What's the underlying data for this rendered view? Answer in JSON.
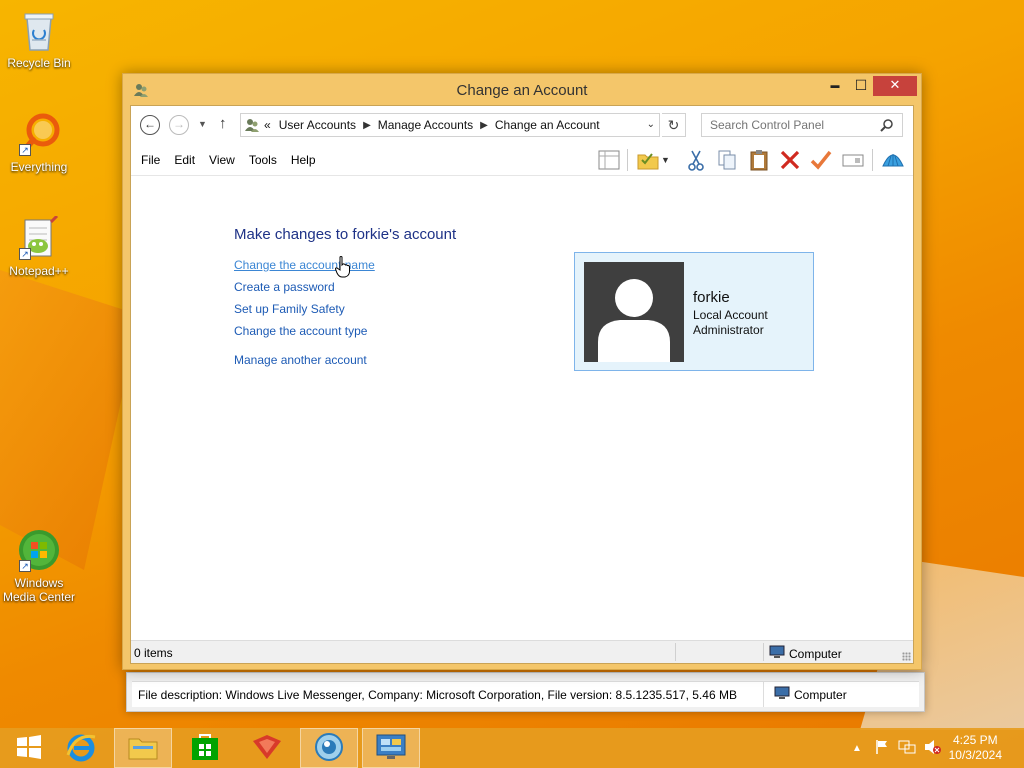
{
  "desktop": {
    "icons": [
      {
        "label": "Recycle Bin",
        "icon": "recycle-bin-icon"
      },
      {
        "label": "Everything",
        "icon": "everything-icon"
      },
      {
        "label": "Notepad++",
        "icon": "notepadpp-icon"
      },
      {
        "label": "Windows Media Center",
        "icon": "media-center-icon"
      }
    ]
  },
  "window": {
    "title": "Change an Account",
    "controls": {
      "minimize": "▬",
      "maximize": "☐",
      "close": "✕"
    },
    "breadcrumb": {
      "overflow": "«",
      "items": [
        "User Accounts",
        "Manage Accounts",
        "Change an Account"
      ]
    },
    "search": {
      "placeholder": "Search Control Panel"
    },
    "menu": [
      "File",
      "Edit",
      "View",
      "Tools",
      "Help"
    ],
    "toolbar": [
      "layout-icon",
      "folder-check-icon",
      "cut-icon",
      "copy-icon",
      "paste-icon",
      "delete-icon",
      "check-icon",
      "rename-icon",
      "shell-icon"
    ]
  },
  "content": {
    "heading": "Make changes to forkie's account",
    "links": [
      "Change the account name",
      "Create a password",
      "Set up Family Safety",
      "Change the account type",
      "Manage another account"
    ],
    "account": {
      "name": "forkie",
      "type": "Local Account",
      "role": "Administrator"
    }
  },
  "statusbar": {
    "items": "0 items",
    "location": "Computer"
  },
  "back_window": {
    "description": "File description: Windows Live Messenger, Company: Microsoft Corporation, File version: 8.5.1235.517,  5.46 MB",
    "location": "Computer"
  },
  "taskbar": {
    "items": [
      "start-icon",
      "internet-explorer-icon",
      "file-explorer-icon",
      "store-icon",
      "app-icon",
      "messenger-icon",
      "control-panel-icon"
    ],
    "time": "4:25 PM",
    "date": "10/3/2024"
  },
  "colors": {
    "accent": "#f5a300",
    "link": "#1d5bb5",
    "heading": "#1e3287",
    "close": "#c7423c"
  }
}
